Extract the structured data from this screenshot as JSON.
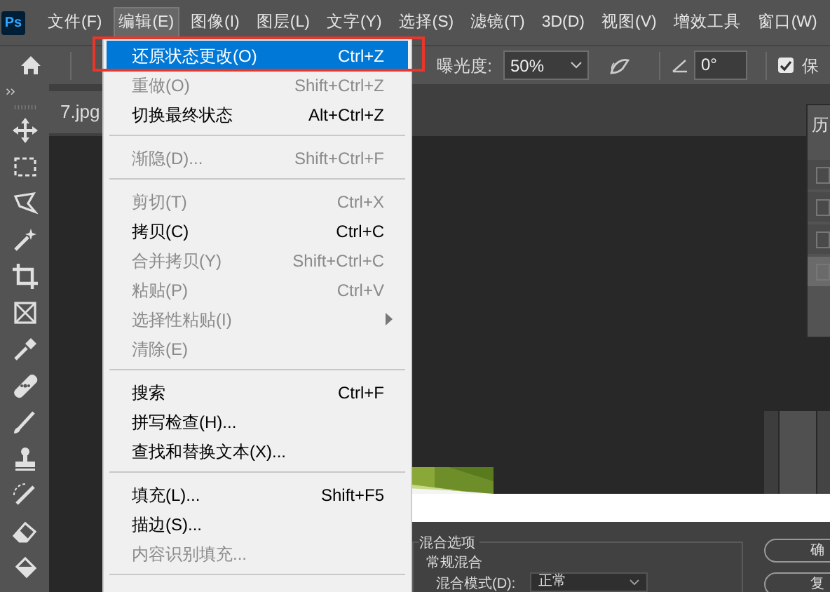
{
  "app": {
    "logo": "Ps"
  },
  "menu_bar": [
    {
      "label": "文件(F)",
      "selected": false
    },
    {
      "label": "编辑(E)",
      "selected": true
    },
    {
      "label": "图像(I)",
      "selected": false
    },
    {
      "label": "图层(L)",
      "selected": false
    },
    {
      "label": "文字(Y)",
      "selected": false
    },
    {
      "label": "选择(S)",
      "selected": false
    },
    {
      "label": "滤镜(T)",
      "selected": false
    },
    {
      "label": "3D(D)",
      "selected": false
    },
    {
      "label": "视图(V)",
      "selected": false
    },
    {
      "label": "增效工具",
      "selected": false
    },
    {
      "label": "窗口(W)",
      "selected": false
    }
  ],
  "options_bar": {
    "exposure_label": "曝光度:",
    "exposure_value": "50%",
    "angle_value": "0°",
    "protect_checked": true,
    "protect_label": "保"
  },
  "document_tab": {
    "title": "7.jpg"
  },
  "edit_menu": [
    {
      "kind": "item",
      "label": "还原状态更改(O)",
      "shortcut": "Ctrl+Z",
      "disabled": false,
      "selected": true,
      "submenu": false
    },
    {
      "kind": "item",
      "label": "重做(O)",
      "shortcut": "Shift+Ctrl+Z",
      "disabled": true,
      "selected": false,
      "submenu": false
    },
    {
      "kind": "item",
      "label": "切换最终状态",
      "shortcut": "Alt+Ctrl+Z",
      "disabled": false,
      "selected": false,
      "submenu": false
    },
    {
      "kind": "separator"
    },
    {
      "kind": "item",
      "label": "渐隐(D)...",
      "shortcut": "Shift+Ctrl+F",
      "disabled": true,
      "selected": false,
      "submenu": false
    },
    {
      "kind": "separator"
    },
    {
      "kind": "item",
      "label": "剪切(T)",
      "shortcut": "Ctrl+X",
      "disabled": true,
      "selected": false,
      "submenu": false
    },
    {
      "kind": "item",
      "label": "拷贝(C)",
      "shortcut": "Ctrl+C",
      "disabled": false,
      "selected": false,
      "submenu": false
    },
    {
      "kind": "item",
      "label": "合并拷贝(Y)",
      "shortcut": "Shift+Ctrl+C",
      "disabled": true,
      "selected": false,
      "submenu": false
    },
    {
      "kind": "item",
      "label": "粘贴(P)",
      "shortcut": "Ctrl+V",
      "disabled": true,
      "selected": false,
      "submenu": false
    },
    {
      "kind": "item",
      "label": "选择性粘贴(I)",
      "disabled": true,
      "selected": false,
      "submenu": true
    },
    {
      "kind": "item",
      "label": "清除(E)",
      "disabled": true,
      "selected": false,
      "submenu": false
    },
    {
      "kind": "separator"
    },
    {
      "kind": "item",
      "label": "搜索",
      "shortcut": "Ctrl+F",
      "disabled": false,
      "selected": false,
      "submenu": false
    },
    {
      "kind": "item",
      "label": "拼写检查(H)...",
      "disabled": false,
      "selected": false,
      "submenu": false
    },
    {
      "kind": "item",
      "label": "查找和替换文本(X)...",
      "disabled": false,
      "selected": false,
      "submenu": false
    },
    {
      "kind": "separator"
    },
    {
      "kind": "item",
      "label": "填充(L)...",
      "shortcut": "Shift+F5",
      "disabled": false,
      "selected": false,
      "submenu": false
    },
    {
      "kind": "item",
      "label": "描边(S)...",
      "disabled": false,
      "selected": false,
      "submenu": false
    },
    {
      "kind": "item",
      "label": "内容识别填充...",
      "disabled": true,
      "selected": false,
      "submenu": false
    },
    {
      "kind": "separator"
    }
  ],
  "history_panel": {
    "title": "历",
    "rows": [
      {
        "selected": false
      },
      {
        "selected": false
      },
      {
        "selected": false
      },
      {
        "selected": true
      }
    ]
  },
  "dialog": {
    "section": "混合选项",
    "group": "常规混合",
    "blend_mode_label": "混合模式(D):",
    "blend_mode_value": "正常",
    "buttons": [
      "确",
      "复"
    ]
  }
}
